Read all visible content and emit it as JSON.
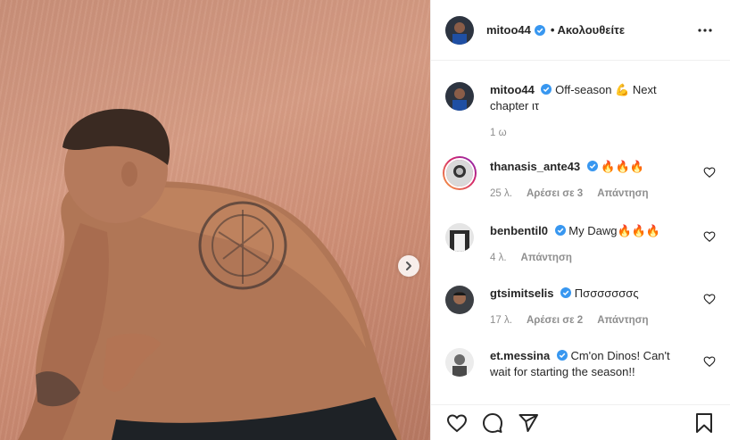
{
  "post": {
    "author": "mitoo44",
    "follow_label": "• Ακολουθείτε",
    "caption_text": "Off-season 💪 Next chapter ιτ",
    "caption_time": "1 ω"
  },
  "comments": [
    {
      "user": "thanasis_ante43",
      "text": "🔥🔥🔥",
      "time": "25 λ.",
      "likes": "Αρέσει σε 3",
      "reply": "Απάντηση"
    },
    {
      "user": "benbentil0",
      "text": "My Dawg🔥🔥🔥",
      "time": "4 λ.",
      "reply": "Απάντηση"
    },
    {
      "user": "gtsimitselis",
      "text": "Πσσσσσσσς",
      "time": "17 λ.",
      "likes": "Αρέσει σε 2",
      "reply": "Απάντηση"
    },
    {
      "user": "et.messina",
      "text": "Cm'on Dinos! Can't wait for starting the season!!"
    }
  ],
  "colors": {
    "verified": "#3897f0",
    "muted": "#8e8e8e",
    "text": "#262626",
    "track": "#cf927b"
  },
  "icons": [
    "verified-badge-icon",
    "more-options-icon",
    "heart-icon",
    "comment-icon",
    "share-icon",
    "bookmark-icon",
    "chevron-right-icon"
  ]
}
